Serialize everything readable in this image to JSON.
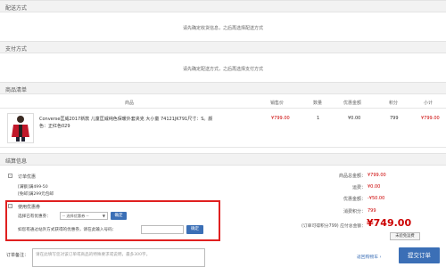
{
  "delivery": {
    "title": "配送方式",
    "notice": "请先确定收货信息，之后再选择配送方式"
  },
  "payment": {
    "title": "支付方式",
    "notice": "请先确定配送方式，之后再选择支付方式"
  },
  "goods": {
    "title": "商品清单",
    "columns": [
      "商品",
      "销售价",
      "数量",
      "优惠金额",
      "积分",
      "小计"
    ],
    "rows": [
      {
        "name": "Converse匡威2017新款 儿童匡威纯色保暖外套夹克 大小童 74121JK791尺寸：S。颜色：正红色029",
        "price": "¥799.00",
        "qty": "1",
        "discount": "¥0.00",
        "points": "799",
        "subtotal": "¥799.00"
      }
    ]
  },
  "checkout": {
    "title": "结算信息",
    "order_promo": {
      "title": "订单优惠",
      "lines": [
        "[满额]满499-50",
        "[免邮]满299元包邮"
      ]
    },
    "coupon": {
      "title": "使用优惠券",
      "select_label": "选择已有优惠券：",
      "select_value": "-- 选择优惠券 --",
      "confirm1": "确定",
      "code_label": "如您有通过站外方式获得的优惠券，请在此输入号码：",
      "code_placeholder": "",
      "confirm2": "确定"
    },
    "remark": {
      "label": "订单备注：",
      "placeholder": "请在此填写您对该订单或商品的特殊要求或说明，最多300字。"
    },
    "summary": {
      "goods_total_label": "商品总金额：",
      "goods_total": "¥799.00",
      "shipping_label": "运费：",
      "shipping": "¥0.00",
      "discount_label": "优惠金额：",
      "discount": "-¥50.00",
      "points_label": "消费积分：",
      "points": "799",
      "payable_label": "(订单可得积分799) 应付总金额：",
      "payable": "¥749.00",
      "unused_btn": "未验免运费",
      "back_cart": "返回购物车 ›",
      "submit": "提交订单"
    }
  },
  "colors": {
    "accent_blue": "#3b6fb6",
    "price_red": "#cc0000",
    "highlight_red": "#e02020"
  }
}
